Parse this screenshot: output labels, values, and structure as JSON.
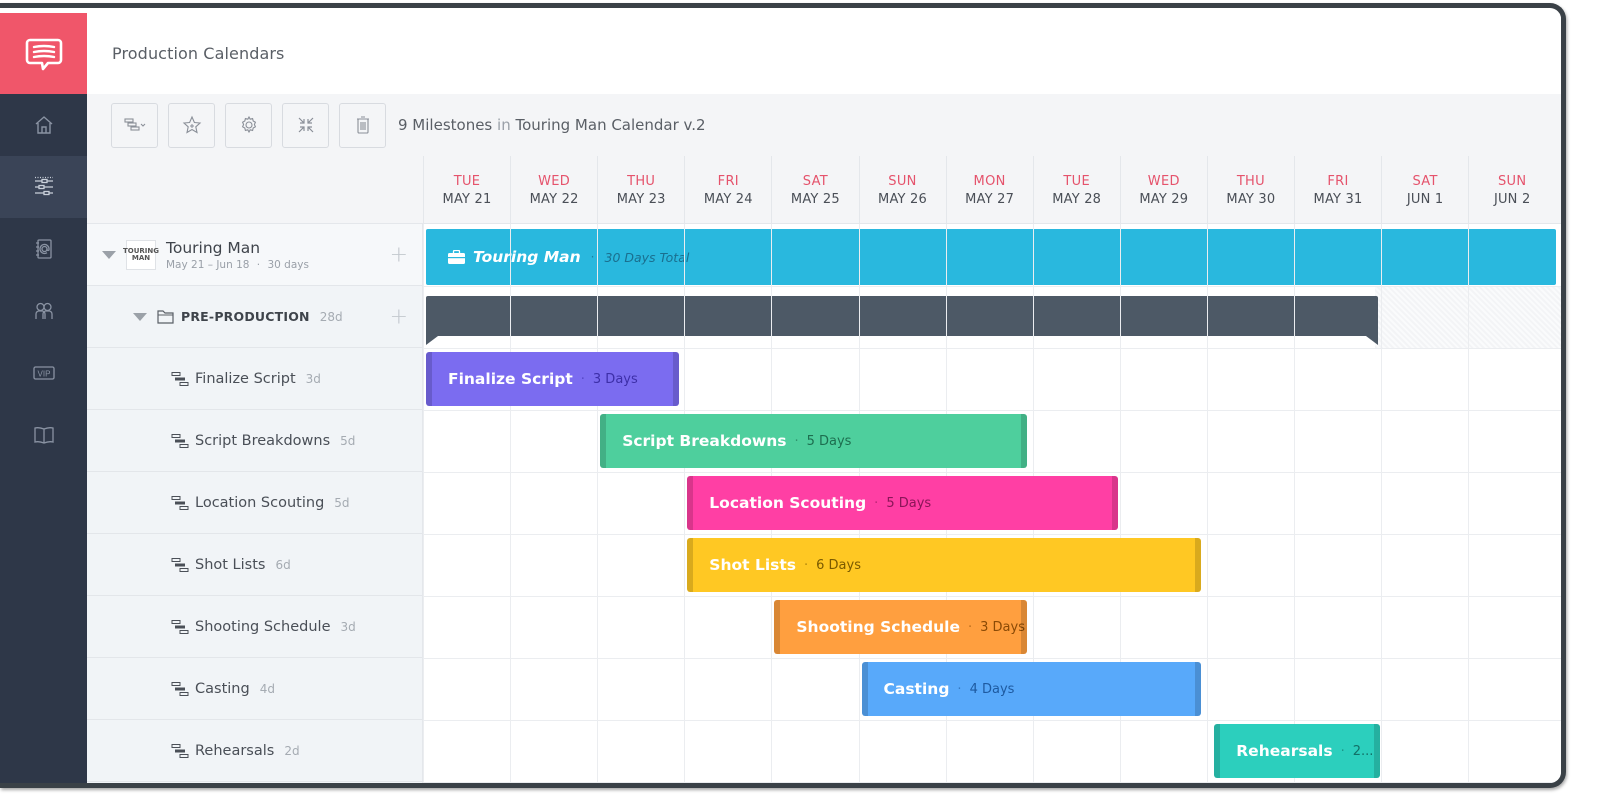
{
  "app": {
    "title": "Production Calendars",
    "brand_color": "#f0566a"
  },
  "sidebar": {
    "items": [
      {
        "icon": "home-icon",
        "label": "Home",
        "active": false
      },
      {
        "icon": "sliders-icon",
        "label": "Production Calendars",
        "active": true
      },
      {
        "icon": "contacts-book-icon",
        "label": "Contacts",
        "active": false
      },
      {
        "icon": "people-icon",
        "label": "Team",
        "active": false
      },
      {
        "icon": "vip-icon",
        "label": "VIP",
        "active": false
      },
      {
        "icon": "book-icon",
        "label": "Library",
        "active": false
      }
    ]
  },
  "toolbar": {
    "buttons": [
      {
        "icon": "gantt-dropdown-icon",
        "label": "View"
      },
      {
        "icon": "star-icon",
        "label": "Favorite"
      },
      {
        "icon": "gear-icon",
        "label": "Settings"
      },
      {
        "icon": "collapse-icon",
        "label": "Collapse"
      },
      {
        "icon": "trash-icon",
        "label": "Delete"
      }
    ],
    "summary_count": "9 Milestones",
    "summary_in": "in",
    "summary_calendar": "Touring Man Calendar v.2"
  },
  "calendar": {
    "days": [
      {
        "dow": "TUE",
        "date": "MAY 21"
      },
      {
        "dow": "WED",
        "date": "MAY 22"
      },
      {
        "dow": "THU",
        "date": "MAY 23"
      },
      {
        "dow": "FRI",
        "date": "MAY 24"
      },
      {
        "dow": "SAT",
        "date": "MAY 25"
      },
      {
        "dow": "SUN",
        "date": "MAY 26"
      },
      {
        "dow": "MON",
        "date": "MAY 27"
      },
      {
        "dow": "TUE",
        "date": "MAY 28"
      },
      {
        "dow": "WED",
        "date": "MAY 29"
      },
      {
        "dow": "THU",
        "date": "MAY 30"
      },
      {
        "dow": "FRI",
        "date": "MAY 31"
      },
      {
        "dow": "SAT",
        "date": "JUN 1"
      },
      {
        "dow": "SUN",
        "date": "JUN 2"
      }
    ]
  },
  "project": {
    "name": "Touring Man",
    "thumb_text": "TOURING MAN",
    "date_range": "May 21 – Jun 18",
    "days": "30 days",
    "bar_label": "Touring Man",
    "bar_total": "30 Days Total",
    "color": "#29b8de"
  },
  "group": {
    "name": "PRE-PRODUCTION",
    "duration": "28d",
    "color": "#4d5966",
    "start_day": 0,
    "span_days": 11
  },
  "tasks": [
    {
      "name": "Finalize Script",
      "duration": "3d",
      "bar_days": "3 Days",
      "start_day": 0,
      "span_days": 2.9,
      "color": "#7b6cf0",
      "text_color": "#3d2fa8"
    },
    {
      "name": "Script Breakdowns",
      "duration": "5d",
      "bar_days": "5 Days",
      "start_day": 2.0,
      "span_days": 4.9,
      "color": "#4ecf9d",
      "text_color": "#1d6e4f"
    },
    {
      "name": "Location Scouting",
      "duration": "5d",
      "bar_days": "5 Days",
      "start_day": 3.0,
      "span_days": 4.95,
      "color": "#ff3fa4",
      "text_color": "#8a1558"
    },
    {
      "name": "Shot Lists",
      "duration": "6d",
      "bar_days": "6 Days",
      "start_day": 3.0,
      "span_days": 5.9,
      "color": "#ffc823",
      "text_color": "#7a5a00"
    },
    {
      "name": "Shooting Schedule",
      "duration": "3d",
      "bar_days": "3 Days",
      "start_day": 4.0,
      "span_days": 2.9,
      "color": "#ff9f3f",
      "text_color": "#8a4a06"
    },
    {
      "name": "Casting",
      "duration": "4d",
      "bar_days": "4 Days",
      "start_day": 5.0,
      "span_days": 3.9,
      "color": "#58a9fa",
      "text_color": "#1e5aa0"
    },
    {
      "name": "Rehearsals",
      "duration": "2d",
      "bar_days": "2...",
      "start_day": 9.05,
      "span_days": 1.9,
      "color": "#2ccfbd",
      "text_color": "#127066"
    }
  ]
}
